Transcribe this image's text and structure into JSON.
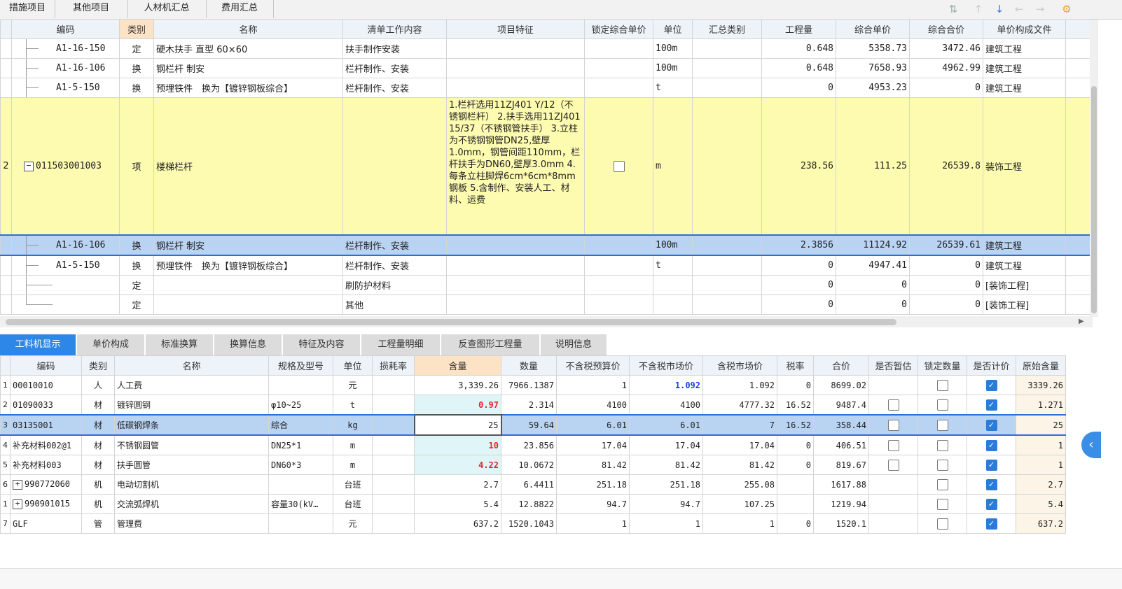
{
  "top_tabs": [
    "措施项目",
    "其他项目",
    "人材机汇总",
    "费用汇总"
  ],
  "upper": {
    "headers": [
      "编码",
      "类别",
      "名称",
      "清单工作内容",
      "项目特征",
      "锁定综合单价",
      "单位",
      "汇总类别",
      "工程量",
      "综合单价",
      "综合合价",
      "单价构成文件"
    ],
    "sorted_header": "类别",
    "rows": [
      {
        "idx": "",
        "code": "A1-16-150",
        "type": "定",
        "name": "硬木扶手 直型 60×60",
        "work": "扶手制作安装",
        "unit": "100m",
        "qty": "0.648",
        "price": "5358.73",
        "total": "3472.46",
        "file": "建筑工程"
      },
      {
        "idx": "",
        "code": "A1-16-106",
        "type": "换",
        "name": "钢栏杆 制安",
        "work": "栏杆制作、安装",
        "unit": "100m",
        "qty": "0.648",
        "price": "7658.93",
        "total": "4962.99",
        "file": "建筑工程"
      },
      {
        "idx": "",
        "code": "A1-5-150",
        "type": "换",
        "name": "预埋铁件　换为【镀锌钢板综合】",
        "work": "栏杆制作、安装",
        "unit": "t",
        "qty": "0",
        "price": "4953.23",
        "total": "0",
        "file": "建筑工程"
      },
      {
        "idx": "2",
        "code": "011503001003",
        "type": "项",
        "name": "楼梯栏杆",
        "work": "",
        "features": "1.栏杆选用11ZJ401 Y/12（不锈钢栏杆）\n2.扶手选用11ZJ401 15/37（不锈钢管扶手）\n3.立柱为不锈钢钢管DN25,壁厚1.0mm，钢管间距110mm，栏杆扶手为DN60,壁厚3.0mm\n4.每条立柱脚焊6cm*6cm*8mm钢板\n5.含制作、安装人工、材料、运费",
        "unit": "m",
        "qty": "238.56",
        "price": "111.25",
        "total": "26539.8",
        "file": "装饰工程"
      },
      {
        "idx": "",
        "code": "A1-16-106",
        "type": "换",
        "name": "钢栏杆 制安",
        "work": "栏杆制作、安装",
        "unit": "100m",
        "qty": "2.3856",
        "price": "11124.92",
        "total": "26539.61",
        "file": "建筑工程"
      },
      {
        "idx": "",
        "code": "A1-5-150",
        "type": "换",
        "name": "预埋铁件　换为【镀锌钢板综合】",
        "work": "栏杆制作、安装",
        "unit": "t",
        "qty": "0",
        "price": "4947.41",
        "total": "0",
        "file": "建筑工程"
      },
      {
        "idx": "",
        "code": "",
        "type": "定",
        "name": "",
        "work": "刷防护材料",
        "unit": "",
        "qty": "0",
        "price": "0",
        "total": "0",
        "file": "[装饰工程]"
      },
      {
        "idx": "",
        "code": "",
        "type": "定",
        "name": "",
        "work": "其他",
        "unit": "",
        "qty": "0",
        "price": "0",
        "total": "0",
        "file": "[装饰工程]"
      }
    ]
  },
  "bottom_tabs": [
    "工料机显示",
    "单价构成",
    "标准换算",
    "换算信息",
    "特征及内容",
    "工程量明细",
    "反查图形工程量",
    "说明信息"
  ],
  "lower": {
    "headers": [
      "编码",
      "类别",
      "名称",
      "规格及型号",
      "单位",
      "损耗率",
      "含量",
      "数量",
      "不含税预算价",
      "不含税市场价",
      "含税市场价",
      "税率",
      "合价",
      "是否暂估",
      "锁定数量",
      "是否计价",
      "原始含量"
    ],
    "highlight_header": "含量",
    "rows": [
      {
        "idx": "1",
        "code": "00010010",
        "type": "人",
        "name": "人工费",
        "spec": "",
        "unit": "元",
        "amount": "3,339.26",
        "qty": "7966.1387",
        "budget": "1",
        "market": "1.092",
        "market_tax": "1.092",
        "tax": "0",
        "total": "8699.02",
        "orig": "3339.26"
      },
      {
        "idx": "2",
        "code": "01090033",
        "type": "材",
        "name": "镀锌圆钢",
        "spec": "φ10~25",
        "unit": "t",
        "amount": "0.97",
        "qty": "2.314",
        "budget": "4100",
        "market": "4100",
        "market_tax": "4777.32",
        "tax": "16.52",
        "total": "9487.4",
        "orig": "1.271"
      },
      {
        "idx": "3",
        "code": "03135001",
        "type": "材",
        "name": "低碳钢焊条",
        "spec": "综合",
        "unit": "kg",
        "amount": "25",
        "qty": "59.64",
        "budget": "6.01",
        "market": "6.01",
        "market_tax": "7",
        "tax": "16.52",
        "total": "358.44",
        "orig": "25"
      },
      {
        "idx": "4",
        "code": "补充材料002@1",
        "type": "材",
        "name": "不锈钢圆管",
        "spec": "DN25*1",
        "unit": "m",
        "amount": "10",
        "qty": "23.856",
        "budget": "17.04",
        "market": "17.04",
        "market_tax": "17.04",
        "tax": "0",
        "total": "406.51",
        "orig": "1"
      },
      {
        "idx": "5",
        "code": "补充材料003",
        "type": "材",
        "name": "扶手圆管",
        "spec": "DN60*3",
        "unit": "m",
        "amount": "4.22",
        "qty": "10.0672",
        "budget": "81.42",
        "market": "81.42",
        "market_tax": "81.42",
        "tax": "0",
        "total": "819.67",
        "orig": "1"
      },
      {
        "idx": "6",
        "code": "990772060",
        "type": "机",
        "name": "电动切割机",
        "spec": "",
        "unit": "台班",
        "amount": "2.7",
        "qty": "6.4411",
        "budget": "251.18",
        "market": "251.18",
        "market_tax": "255.08",
        "tax": "",
        "total": "1617.88",
        "orig": "2.7"
      },
      {
        "idx": "1",
        "code": "990901015",
        "type": "机",
        "name": "交流弧焊机",
        "spec": "容量30(kV…",
        "unit": "台班",
        "amount": "5.4",
        "qty": "12.8822",
        "budget": "94.7",
        "market": "94.7",
        "market_tax": "107.25",
        "tax": "",
        "total": "1219.94",
        "orig": "5.4"
      },
      {
        "idx": "7",
        "code": "GLF",
        "type": "管",
        "name": "管理费",
        "spec": "",
        "unit": "元",
        "amount": "637.2",
        "qty": "1520.1043",
        "budget": "1",
        "market": "1",
        "market_tax": "1",
        "tax": "0",
        "total": "1520.1",
        "orig": "637.2"
      }
    ]
  },
  "colors": {
    "selected_row": "#b9d3f3",
    "feature_row": "#fdfbb0",
    "active_tab": "#2c87e8",
    "checkbox_on": "#2b7bd8",
    "red_value": "#e0262b",
    "blue_value": "#1c3fe0"
  }
}
